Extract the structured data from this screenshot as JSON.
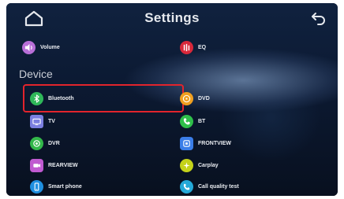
{
  "header": {
    "title": "Settings"
  },
  "section": {
    "device": "Device"
  },
  "items": {
    "volume": "Volume",
    "eq": "EQ",
    "bluetooth": "Bluetooth",
    "dvd": "DVD",
    "tv": "TV",
    "bt": "BT",
    "dvr": "DVR",
    "frontview": "FRONTVIEW",
    "rearview": "REARVIEW",
    "carplay": "Carplay",
    "smartphone": "Smart phone",
    "callquality": "Call quality test"
  },
  "colors": {
    "highlight": "#e2242c",
    "volume": "#b86fd8",
    "eq": "#d8283a",
    "bluetooth": "#2fb85a",
    "dvd": "#f0a020",
    "tv": "#7b7fe0",
    "bt": "#2fbf4a",
    "dvr": "#33b84a",
    "frontview": "#3b7ee8",
    "rearview": "#c05ad0",
    "carplay": "#c4d21a",
    "smartphone": "#1f8fe0",
    "callquality": "#24a9d8"
  },
  "icons": {
    "home": "home-icon",
    "back": "back-arrow-icon"
  }
}
